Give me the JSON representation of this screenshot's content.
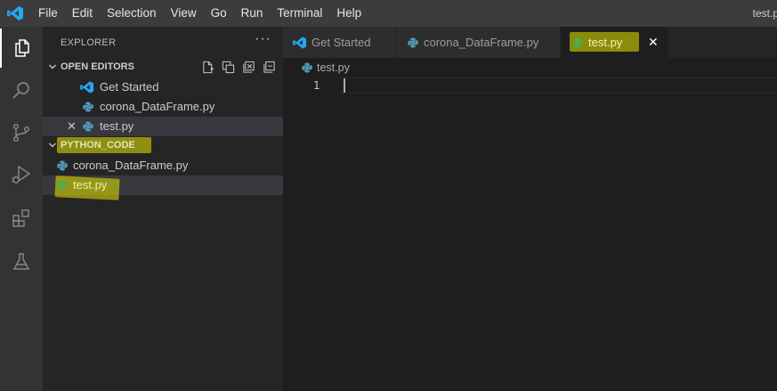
{
  "menu": {
    "items": [
      "File",
      "Edit",
      "Selection",
      "View",
      "Go",
      "Run",
      "Terminal",
      "Help"
    ],
    "window_title": "test.py"
  },
  "activity_bar": {
    "icons": [
      "explorer-icon",
      "search-icon",
      "source-control-icon",
      "run-debug-icon",
      "extensions-icon",
      "testing-icon"
    ]
  },
  "explorer": {
    "header": "EXPLORER",
    "more": "···",
    "open_editors": {
      "title": "OPEN EDITORS",
      "items": [
        {
          "label": "Get Started",
          "icon": "vscode-icon"
        },
        {
          "label": "corona_DataFrame.py",
          "icon": "python-icon"
        },
        {
          "label": "test.py",
          "icon": "python-icon",
          "close": "✕"
        }
      ]
    },
    "folder": {
      "title": "PYTHON_CODE",
      "items": [
        {
          "label": "corona_DataFrame.py",
          "icon": "python-icon"
        },
        {
          "label": "test.py",
          "icon": "python-icon"
        }
      ]
    }
  },
  "editor": {
    "tabs": [
      {
        "label": "Get Started",
        "icon": "vscode-icon"
      },
      {
        "label": "corona_DataFrame.py",
        "icon": "python-icon"
      },
      {
        "label": "test.py",
        "icon": "python-icon",
        "close": "✕"
      }
    ],
    "breadcrumb": "test.py",
    "line_number": "1"
  },
  "colors": {
    "accent": "#007acc",
    "python_blue": "#519aba",
    "highlight_yellow": "#e6e600"
  }
}
